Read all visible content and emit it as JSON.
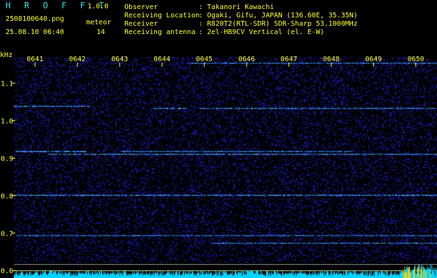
{
  "header": {
    "brand": "H R O F F T",
    "version": "1.0.0",
    "filename": "2508100640.png",
    "meteor_label": "meteor",
    "datetime": "25.08.10 06:40",
    "meteor_count": "14"
  },
  "info": [
    {
      "key": "Observer",
      "value": ": Takanori Kawachi"
    },
    {
      "key": "Receiving Location",
      "value": ": Ogaki, Gifu, JAPAN (136.60E, 35.35N)"
    },
    {
      "key": "Receiver",
      "value": ": R820T2(RTL-SDR) SDR-Sharp 53.1000MHz"
    },
    {
      "key": "Receiving antenna",
      "value": ": 2el-HB9CV Vertical (el. E-W)"
    }
  ],
  "colors": {
    "text_cyan": "#2fe0e6",
    "text_yellow": "#ffff2a",
    "background": "#000000",
    "noise_floor": "#1b1b8a",
    "signal": "#2e8bff",
    "signal_hot": "#8ad8ff",
    "baseline": "#00d4ff",
    "burst": "#ffd400"
  },
  "chart_data": {
    "type": "heatmap",
    "ylabel": "kHz",
    "y_ticks": [
      "1.1",
      "1.0",
      "0.9",
      "0.8",
      "0.7",
      "0.6"
    ],
    "x_ticks": [
      "0641",
      "0642",
      "0643",
      "0644",
      "0645",
      "0646",
      "0647",
      "0648",
      "0649",
      "0650"
    ],
    "ylim": [
      0.58,
      1.17
    ],
    "xlim": [
      640.5,
      650.5
    ],
    "traces": [
      {
        "freq": 1.155,
        "start": 644.6,
        "end": 650.5,
        "intensity": 0.55
      },
      {
        "freq": 1.04,
        "start": 640.5,
        "end": 642.3,
        "intensity": 0.45
      },
      {
        "freq": 1.035,
        "start": 643.8,
        "end": 644.6,
        "intensity": 0.6
      },
      {
        "freq": 1.035,
        "start": 644.9,
        "end": 650.5,
        "intensity": 0.55
      },
      {
        "freq": 0.92,
        "start": 640.5,
        "end": 642.2,
        "intensity": 0.8
      },
      {
        "freq": 0.912,
        "start": 641.3,
        "end": 650.5,
        "intensity": 0.75
      },
      {
        "freq": 0.92,
        "start": 643.0,
        "end": 648.5,
        "intensity": 0.6
      },
      {
        "freq": 0.802,
        "start": 640.5,
        "end": 650.5,
        "intensity": 0.6
      },
      {
        "freq": 0.695,
        "start": 640.5,
        "end": 650.5,
        "intensity": 0.25
      },
      {
        "freq": 0.675,
        "start": 645.2,
        "end": 650.5,
        "intensity": 0.55
      }
    ]
  }
}
